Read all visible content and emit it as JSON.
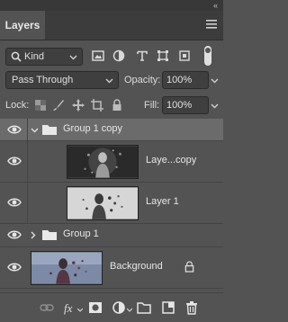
{
  "panel": {
    "collapse_glyph": "«",
    "tab_label": "Layers",
    "menu_icon": "hamburger-menu-icon"
  },
  "filter": {
    "kind_label": "Kind",
    "icons": [
      "image-filter-icon",
      "adjustment-filter-icon",
      "type-filter-icon",
      "shape-filter-icon",
      "smart-object-filter-icon"
    ]
  },
  "blend": {
    "mode": "Pass Through",
    "opacity_label": "Opacity:",
    "opacity_value": "100%"
  },
  "lock": {
    "label": "Lock:",
    "fill_label": "Fill:",
    "fill_value": "100%"
  },
  "layers": [
    {
      "name": "Group 1 copy",
      "type": "group",
      "expanded": true,
      "selected": true
    },
    {
      "name": "Laye...copy",
      "type": "pixel",
      "thumb": "dark-dispersion"
    },
    {
      "name": "Layer 1",
      "type": "pixel",
      "thumb": "light-dispersion"
    },
    {
      "name": "Group 1",
      "type": "group",
      "expanded": false
    },
    {
      "name": "Background",
      "type": "pixel",
      "locked": true
    }
  ],
  "bottom_icons": [
    "link-icon",
    "fx-icon",
    "mask-icon",
    "adjustment-icon",
    "group-folder-icon",
    "new-layer-icon",
    "trash-icon"
  ],
  "colors": {
    "panel_bg": "#535353",
    "selected_row": "#6b6b6b",
    "tab_bar": "#3c3c3c"
  }
}
